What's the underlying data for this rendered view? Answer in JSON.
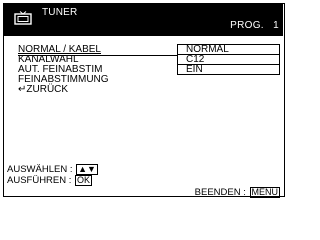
{
  "header": {
    "title": "TUNER",
    "prog_label": "PROG.",
    "prog_number": "1",
    "icon": "tv-icon"
  },
  "menu": {
    "items": [
      {
        "label": "NORMAL / KABEL",
        "selected": true
      },
      {
        "label": "KANALWAHL",
        "selected": false
      },
      {
        "label": "AUT. FEINABSTIM",
        "selected": false
      },
      {
        "label": "FEINABSTIMMUNG",
        "selected": false
      },
      {
        "label": "ZURÜCK",
        "selected": false
      }
    ],
    "back_icon": "return-arrow-icon"
  },
  "values": [
    "NORMAL",
    "C12",
    "EIN"
  ],
  "footer": {
    "select_label": "AUSWÄHLEN",
    "select_key": "up-down-arrows-icon",
    "execute_label": "AUSFÜHREN",
    "execute_key": "OK",
    "exit_label": "BEENDEN",
    "exit_key": "MENU"
  }
}
